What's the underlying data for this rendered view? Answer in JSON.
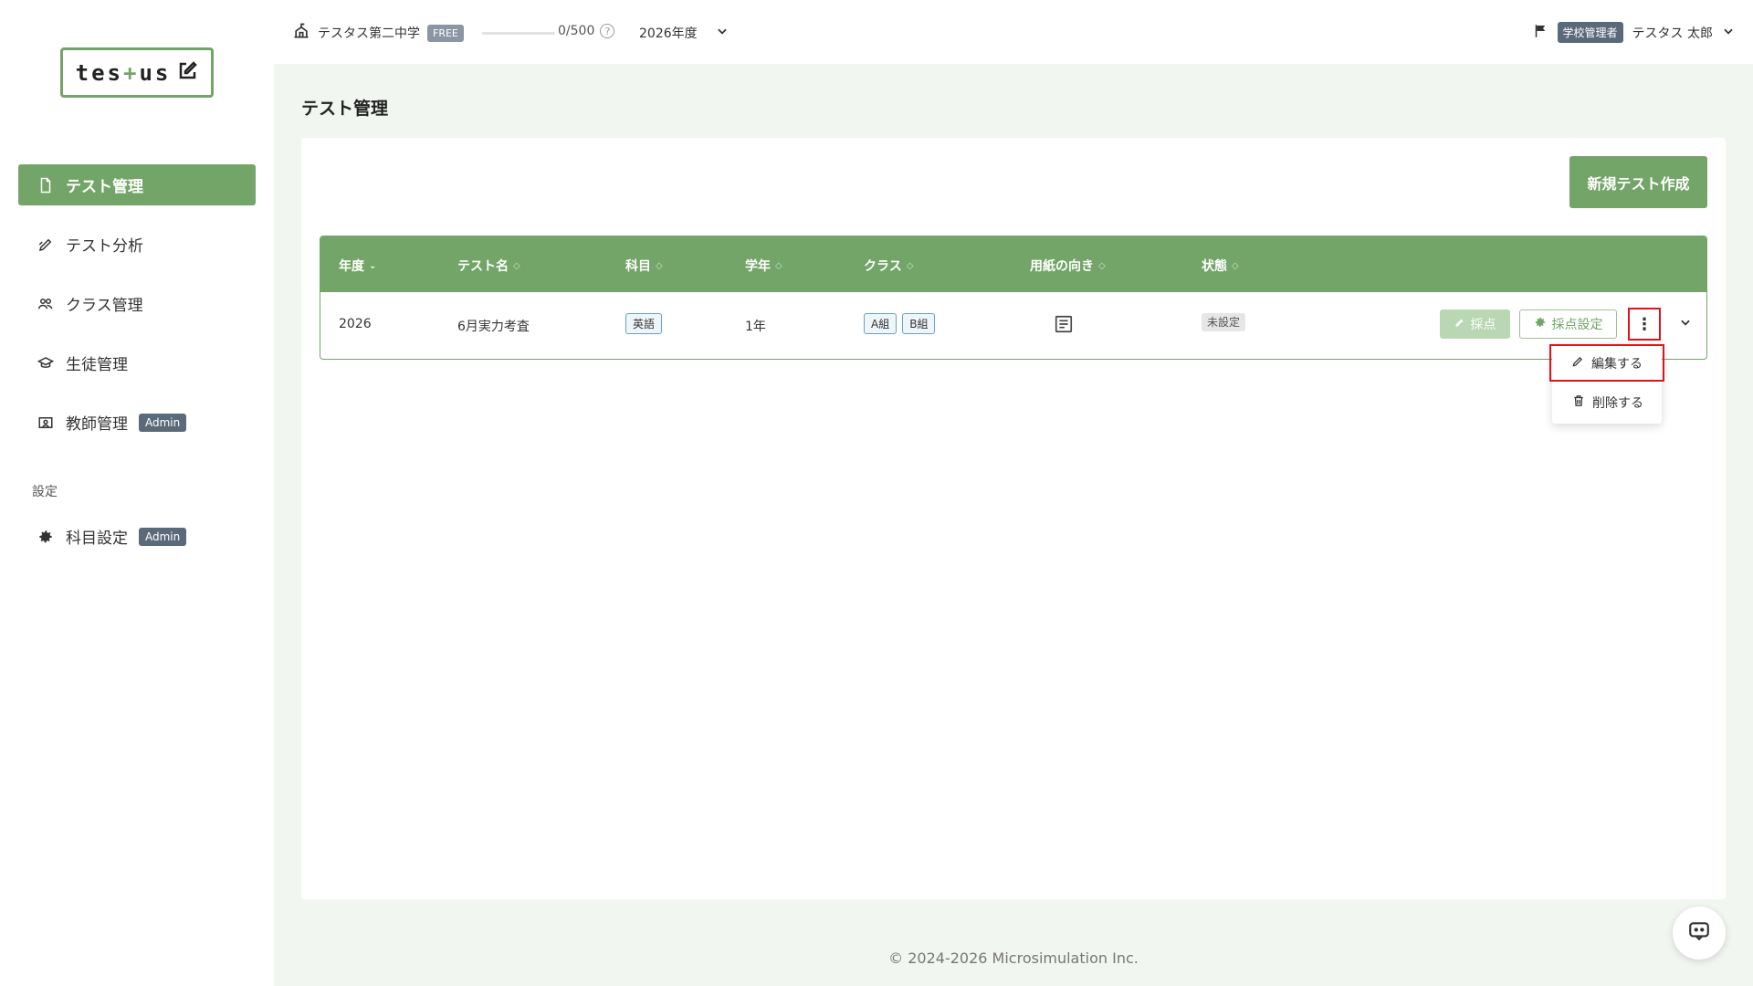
{
  "logo": {
    "text_before": "tes",
    "text_plus": "+",
    "text_after": "us"
  },
  "sidebar": {
    "items": [
      {
        "label": "テスト管理",
        "icon": "document-icon",
        "active": true
      },
      {
        "label": "テスト分析",
        "icon": "pencil-chart-icon"
      },
      {
        "label": "クラス管理",
        "icon": "group-icon"
      },
      {
        "label": "生徒管理",
        "icon": "graduation-cap-icon"
      },
      {
        "label": "教師管理",
        "icon": "id-card-icon",
        "badge": "Admin"
      }
    ],
    "section_label": "設定",
    "settings_items": [
      {
        "label": "科目設定",
        "icon": "gear-icon",
        "badge": "Admin"
      }
    ]
  },
  "topbar": {
    "school_name": "テスタス第二中学",
    "plan_badge": "FREE",
    "usage": "0/500",
    "usage_fraction": 0,
    "year": "2026年度",
    "role_badge": "学校管理者",
    "user_name": "テスタス 太郎"
  },
  "page": {
    "title": "テスト管理",
    "new_button": "新規テスト作成"
  },
  "table": {
    "columns": [
      "年度",
      "テスト名",
      "科目",
      "学年",
      "クラス",
      "用紙の向き",
      "状態"
    ],
    "rows": [
      {
        "year": "2026",
        "name": "6月実力考査",
        "subject": "英語",
        "grade": "1年",
        "classes": [
          "A組",
          "B組"
        ],
        "orientation_icon": "portrait-sheet-icon",
        "status": "未設定",
        "score_button": "採点",
        "settings_button": "採点設定"
      }
    ]
  },
  "dropdown": {
    "edit": "編集する",
    "delete": "削除する"
  },
  "footer": "© 2024-2026 Microsimulation Inc.",
  "colors": {
    "primary": "#72a567",
    "highlight": "#e0131b",
    "badge": "#5b6a7a"
  }
}
